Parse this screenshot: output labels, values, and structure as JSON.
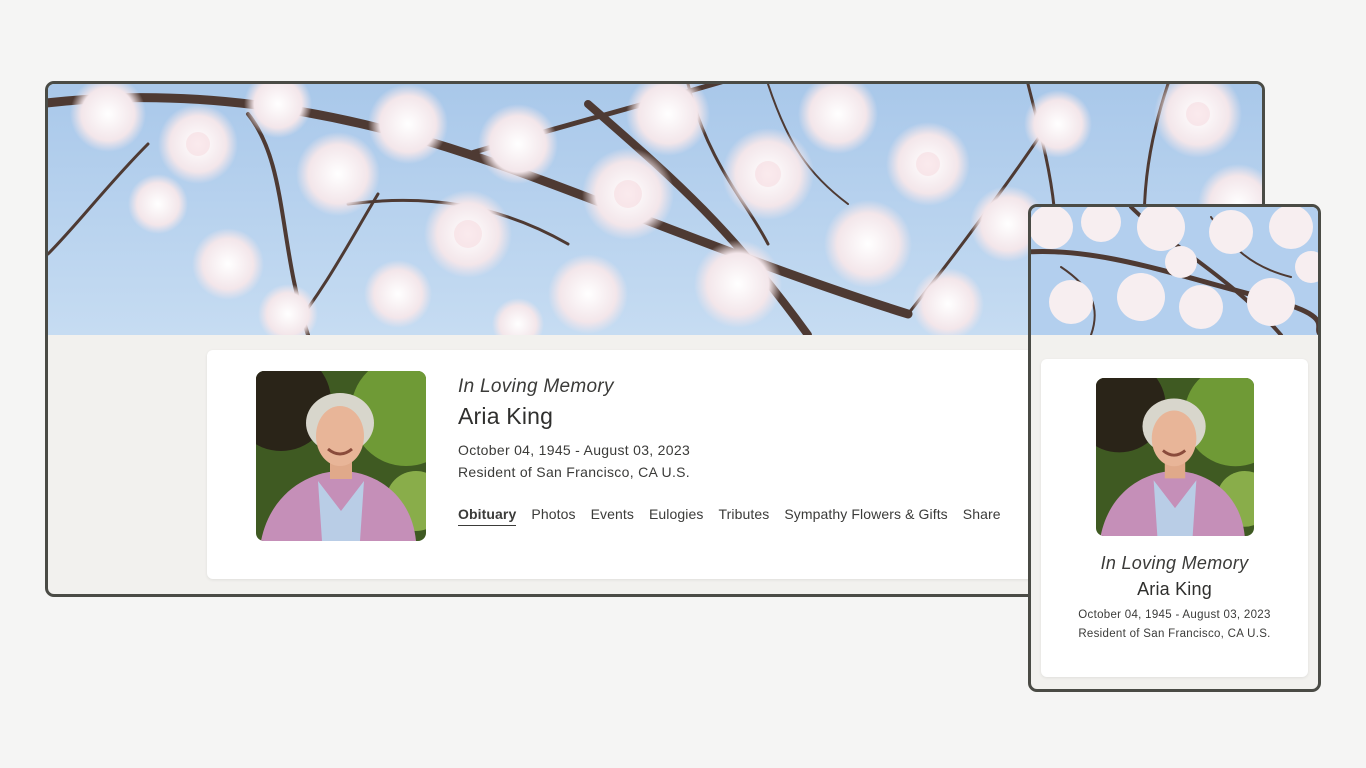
{
  "memorial": {
    "heading": "In Loving Memory",
    "name": "Aria King",
    "dates": "October 04, 1945 - August 03, 2023",
    "residence": "Resident of San Francisco, CA U.S."
  },
  "nav": {
    "tabs": [
      {
        "label": "Obituary",
        "active": true
      },
      {
        "label": "Photos"
      },
      {
        "label": "Events"
      },
      {
        "label": "Eulogies"
      },
      {
        "label": "Tributes"
      },
      {
        "label": "Sympathy Flowers & Gifts"
      },
      {
        "label": "Share"
      }
    ]
  },
  "colors": {
    "frame": "#4a4b45",
    "page_background": "#f5f5f4",
    "card_background": "#ffffff",
    "banner_sky": "#b6d2ee"
  }
}
